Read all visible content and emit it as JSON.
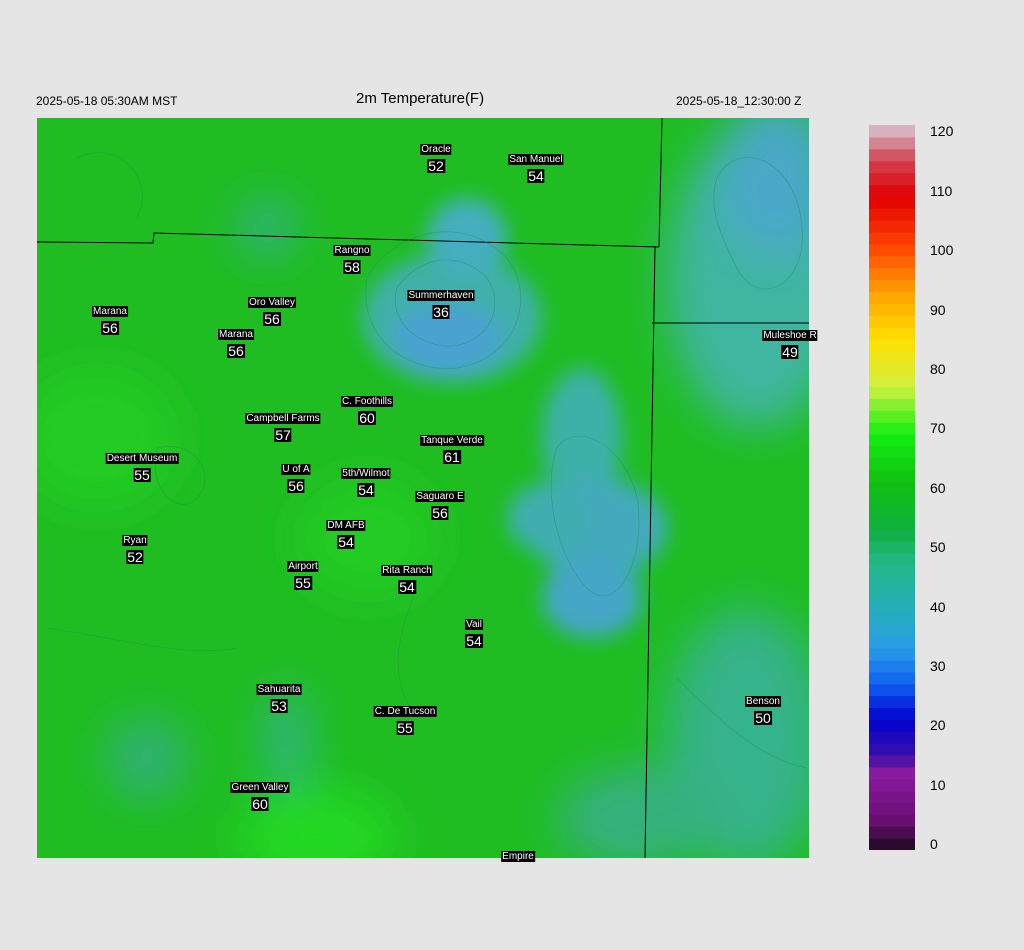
{
  "header": {
    "left": "2025-05-18 05:30AM MST",
    "title": "2m Temperature(F)",
    "right": "2025-05-18_12:30:00 Z"
  },
  "colors": {
    "background": "#e5e5e5",
    "base_green": "#1fbf1f",
    "cool_teal": "#3fb5a3",
    "cold_blue": "#45a6cf",
    "border_line": "#000000"
  },
  "stations": [
    {
      "name": "Oracle",
      "value": "52"
    },
    {
      "name": "San Manuel",
      "value": "54"
    },
    {
      "name": "Rangno",
      "value": "58"
    },
    {
      "name": "Summerhaven",
      "value": "36"
    },
    {
      "name": "Marana",
      "value": "56"
    },
    {
      "name": "Oro Valley",
      "value": "56"
    },
    {
      "name": "Marana",
      "value": "56"
    },
    {
      "name": "Muleshoe R",
      "value": "49"
    },
    {
      "name": "C. Foothills",
      "value": "60"
    },
    {
      "name": "Campbell Farms",
      "value": "57"
    },
    {
      "name": "Tanque Verde",
      "value": "61"
    },
    {
      "name": "Desert Museum",
      "value": "55"
    },
    {
      "name": "U of A",
      "value": "56"
    },
    {
      "name": "5th/Wilmot",
      "value": "54"
    },
    {
      "name": "Saguaro E",
      "value": "56"
    },
    {
      "name": "DM AFB",
      "value": "54"
    },
    {
      "name": "Ryan",
      "value": "52"
    },
    {
      "name": "Airport",
      "value": "55"
    },
    {
      "name": "Rita Ranch",
      "value": "54"
    },
    {
      "name": "Vail",
      "value": "54"
    },
    {
      "name": "Benson",
      "value": "50"
    },
    {
      "name": "Sahuarita",
      "value": "53"
    },
    {
      "name": "C. De Tucson",
      "value": "55"
    },
    {
      "name": "Green Valley",
      "value": "60"
    },
    {
      "name": "Empire",
      "value": ""
    }
  ],
  "colorbar": {
    "min": 0,
    "max": 122,
    "ticks": [
      "0",
      "10",
      "20",
      "30",
      "40",
      "50",
      "60",
      "70",
      "80",
      "90",
      "100",
      "110",
      "120"
    ],
    "stops": [
      {
        "v": 0,
        "c": "#1a0a1c"
      },
      {
        "v": 5,
        "c": "#6a0f72"
      },
      {
        "v": 13,
        "c": "#8a1aa0"
      },
      {
        "v": 16,
        "c": "#3a10a8"
      },
      {
        "v": 22,
        "c": "#0000d0"
      },
      {
        "v": 28,
        "c": "#1060f0"
      },
      {
        "v": 34,
        "c": "#2a9de8"
      },
      {
        "v": 42,
        "c": "#24b0b0"
      },
      {
        "v": 48,
        "c": "#22b88a"
      },
      {
        "v": 54,
        "c": "#10b040"
      },
      {
        "v": 62,
        "c": "#10c010"
      },
      {
        "v": 70,
        "c": "#10f010"
      },
      {
        "v": 78,
        "c": "#d0f040"
      },
      {
        "v": 86,
        "c": "#ffe000"
      },
      {
        "v": 94,
        "c": "#ffa000"
      },
      {
        "v": 102,
        "c": "#ff4000"
      },
      {
        "v": 110,
        "c": "#e00000"
      },
      {
        "v": 116,
        "c": "#d04050"
      },
      {
        "v": 122,
        "c": "#d8c8d0"
      }
    ]
  }
}
